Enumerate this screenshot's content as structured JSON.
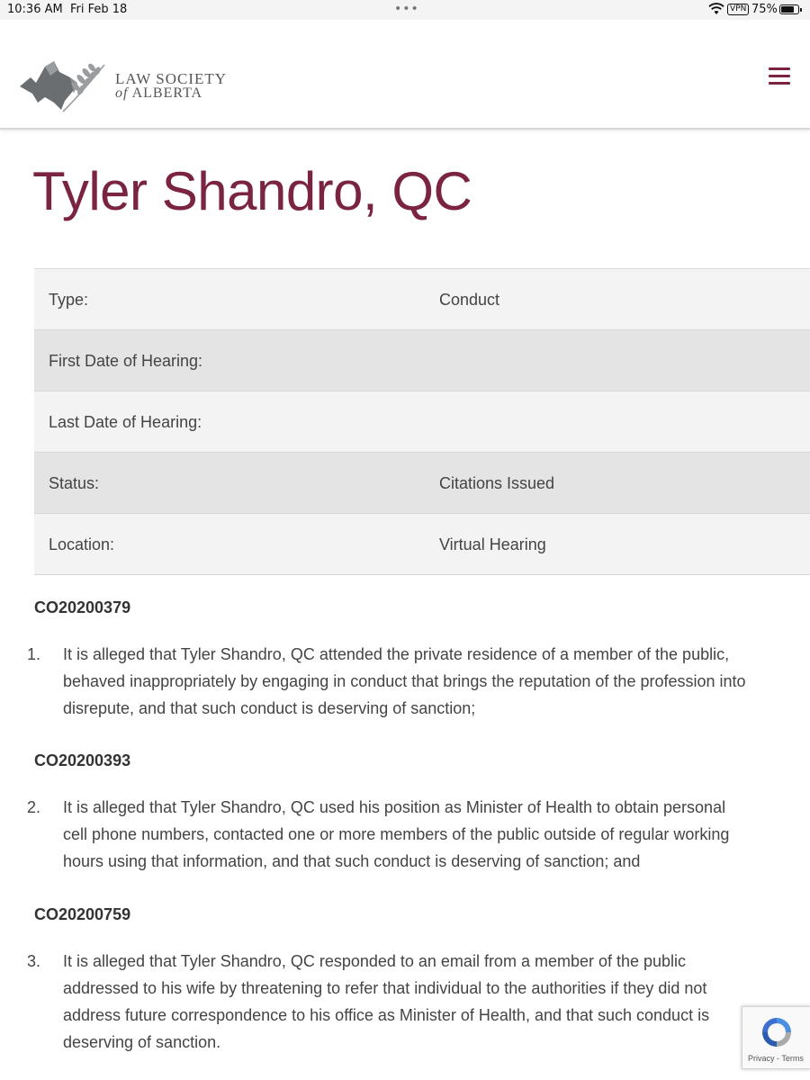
{
  "status_bar": {
    "time": "10:36 AM",
    "date": "Fri Feb 18",
    "vpn": "VPN",
    "battery_percent": "75%",
    "battery_level": 0.75
  },
  "header": {
    "logo_line1": "LAW SOCIETY",
    "logo_line2_prefix": "of",
    "logo_line2": "ALBERTA",
    "menu_icon": "hamburger-menu-icon",
    "accent_color": "#7a2442"
  },
  "page": {
    "title": "Tyler Shandro, QC"
  },
  "details": [
    {
      "label": "Type:",
      "value": "Conduct"
    },
    {
      "label": "First Date of Hearing:",
      "value": ""
    },
    {
      "label": "Last Date of Hearing:",
      "value": ""
    },
    {
      "label": "Status:",
      "value": "Citations Issued"
    },
    {
      "label": "Location:",
      "value": "Virtual Hearing"
    }
  ],
  "charges": [
    {
      "case_id": "CO20200379",
      "number": "1.",
      "lines": [
        "It is alleged that Tyler Shandro, QC attended the private residence of a member of the public,",
        "behaved inappropriately by engaging in conduct that brings the reputation of the profession into",
        "disrepute, and that such conduct is deserving of sanction;"
      ]
    },
    {
      "case_id": "CO20200393",
      "number": "2.",
      "lines": [
        "It is alleged that Tyler Shandro, QC used his position as Minister of Health to obtain personal",
        "cell phone numbers, contacted one or more members of the public outside of regular working",
        "hours using that information, and that such conduct is deserving of sanction; and"
      ]
    },
    {
      "case_id": "CO20200759",
      "number": "3.",
      "lines": [
        "It is alleged that Tyler Shandro, QC responded to an email from a member of the public",
        "addressed to his wife by threatening to refer that individual to the authorities if they did not",
        "address future correspondence to his office as Minister of Health, and that such conduct is",
        "deserving of sanction."
      ]
    }
  ],
  "recaptcha": {
    "links": "Privacy - Terms"
  }
}
